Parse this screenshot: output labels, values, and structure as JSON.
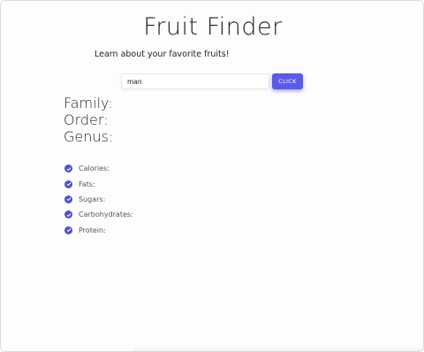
{
  "header": {
    "title": "Fruit Finder",
    "subtitle": "Learn about your favorite fruits!"
  },
  "search": {
    "value": "man",
    "placeholder": "",
    "button_label": "CLICK"
  },
  "taxonomy": {
    "family_label": "Family:",
    "order_label": "Order:",
    "genus_label": "Genus:"
  },
  "nutrition": {
    "items": [
      {
        "label": "Calories:",
        "icon": "check-circle-icon"
      },
      {
        "label": "Fats:",
        "icon": "check-circle-icon"
      },
      {
        "label": "Sugars:",
        "icon": "check-circle-icon"
      },
      {
        "label": "Carbohydrates:",
        "icon": "check-circle-icon"
      },
      {
        "label": "Protein:",
        "icon": "check-circle-icon"
      }
    ]
  },
  "colors": {
    "accent": "#5a5ae8",
    "check": "#5151c8"
  }
}
